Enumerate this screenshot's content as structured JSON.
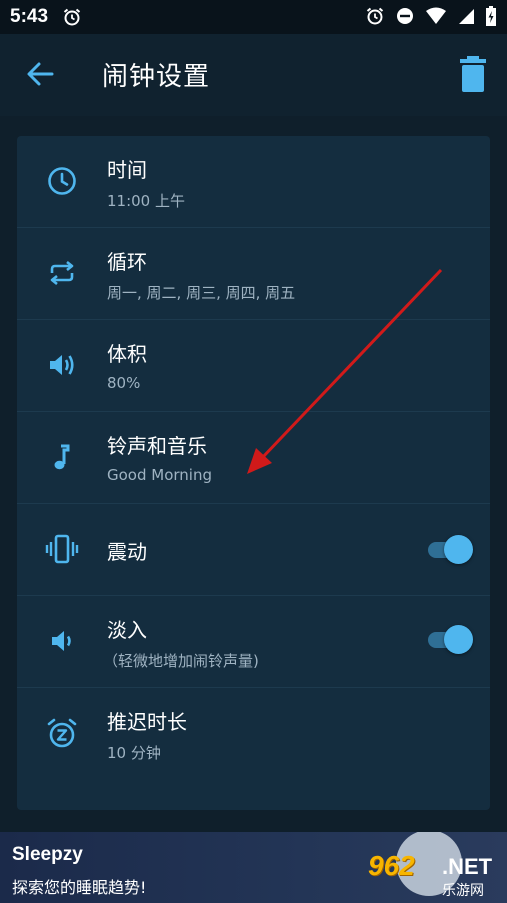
{
  "status_bar": {
    "time": "5:43"
  },
  "app_bar": {
    "title": "闹钟设置"
  },
  "settings": [
    {
      "title": "时间",
      "subtitle": "11:00 上午",
      "icon": "clock-icon"
    },
    {
      "title": "循环",
      "subtitle": "周一, 周二, 周三, 周四, 周五",
      "icon": "repeat-icon"
    },
    {
      "title": "体积",
      "subtitle": "80%",
      "icon": "volume-icon"
    },
    {
      "title": "铃声和音乐",
      "subtitle": "Good Morning",
      "icon": "music-note-icon"
    },
    {
      "title": "震动",
      "icon": "vibrate-icon",
      "toggle_on": true
    },
    {
      "title": "淡入",
      "subtitle": "（轻微地增加闹铃声量)",
      "icon": "volume-low-icon",
      "toggle_on": true
    },
    {
      "title": "推迟时长",
      "subtitle": "10 分钟",
      "icon": "snooze-alarm-icon"
    }
  ],
  "ad": {
    "title": "Sleepzy",
    "subtitle": "探索您的睡眠趋势!"
  },
  "watermark": {
    "number": "962",
    "net": ".NET",
    "text": "乐游网"
  },
  "colors": {
    "accent": "#4fb6ee",
    "background": "#0f1f2b",
    "card": "#142d3f",
    "annotation_arrow": "#d11a1a"
  }
}
